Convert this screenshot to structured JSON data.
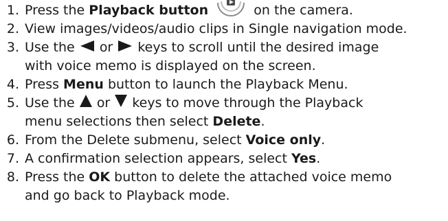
{
  "steps": [
    {
      "num": "1.",
      "parts": {
        "a": "Press the ",
        "b": "Playback button",
        "c": "on the camera."
      }
    },
    {
      "num": "2.",
      "parts": {
        "a": "View images/videos/audio clips in Single navigation mode."
      }
    },
    {
      "num": "3.",
      "parts": {
        "a": "Use the",
        "b": "or",
        "c": "keys to scroll until the desired image",
        "d": "with voice memo is displayed on the screen."
      }
    },
    {
      "num": "4.",
      "parts": {
        "a": "Press ",
        "b": "Menu",
        "c": " button to launch the Playback Menu."
      }
    },
    {
      "num": "5.",
      "parts": {
        "a": "Use the",
        "b": "or",
        "c": "keys to move through the Playback",
        "d": "menu selections then select ",
        "e": "Delete",
        "f": "."
      }
    },
    {
      "num": "6.",
      "parts": {
        "a": "From the Delete submenu, select ",
        "b": "Voice only",
        "c": "."
      }
    },
    {
      "num": "7.",
      "parts": {
        "a": "A confirmation selection appears, select ",
        "b": "Yes",
        "c": "."
      }
    },
    {
      "num": "8.",
      "parts": {
        "a": "Press the ",
        "b": "OK",
        "c": " button to delete the attached voice memo",
        "d": "and go back to Playback mode."
      }
    }
  ],
  "icons": {
    "playback": "playback-button-icon",
    "left": "left-arrow-icon",
    "right": "right-arrow-icon",
    "up": "up-arrow-icon",
    "down": "down-arrow-icon"
  }
}
